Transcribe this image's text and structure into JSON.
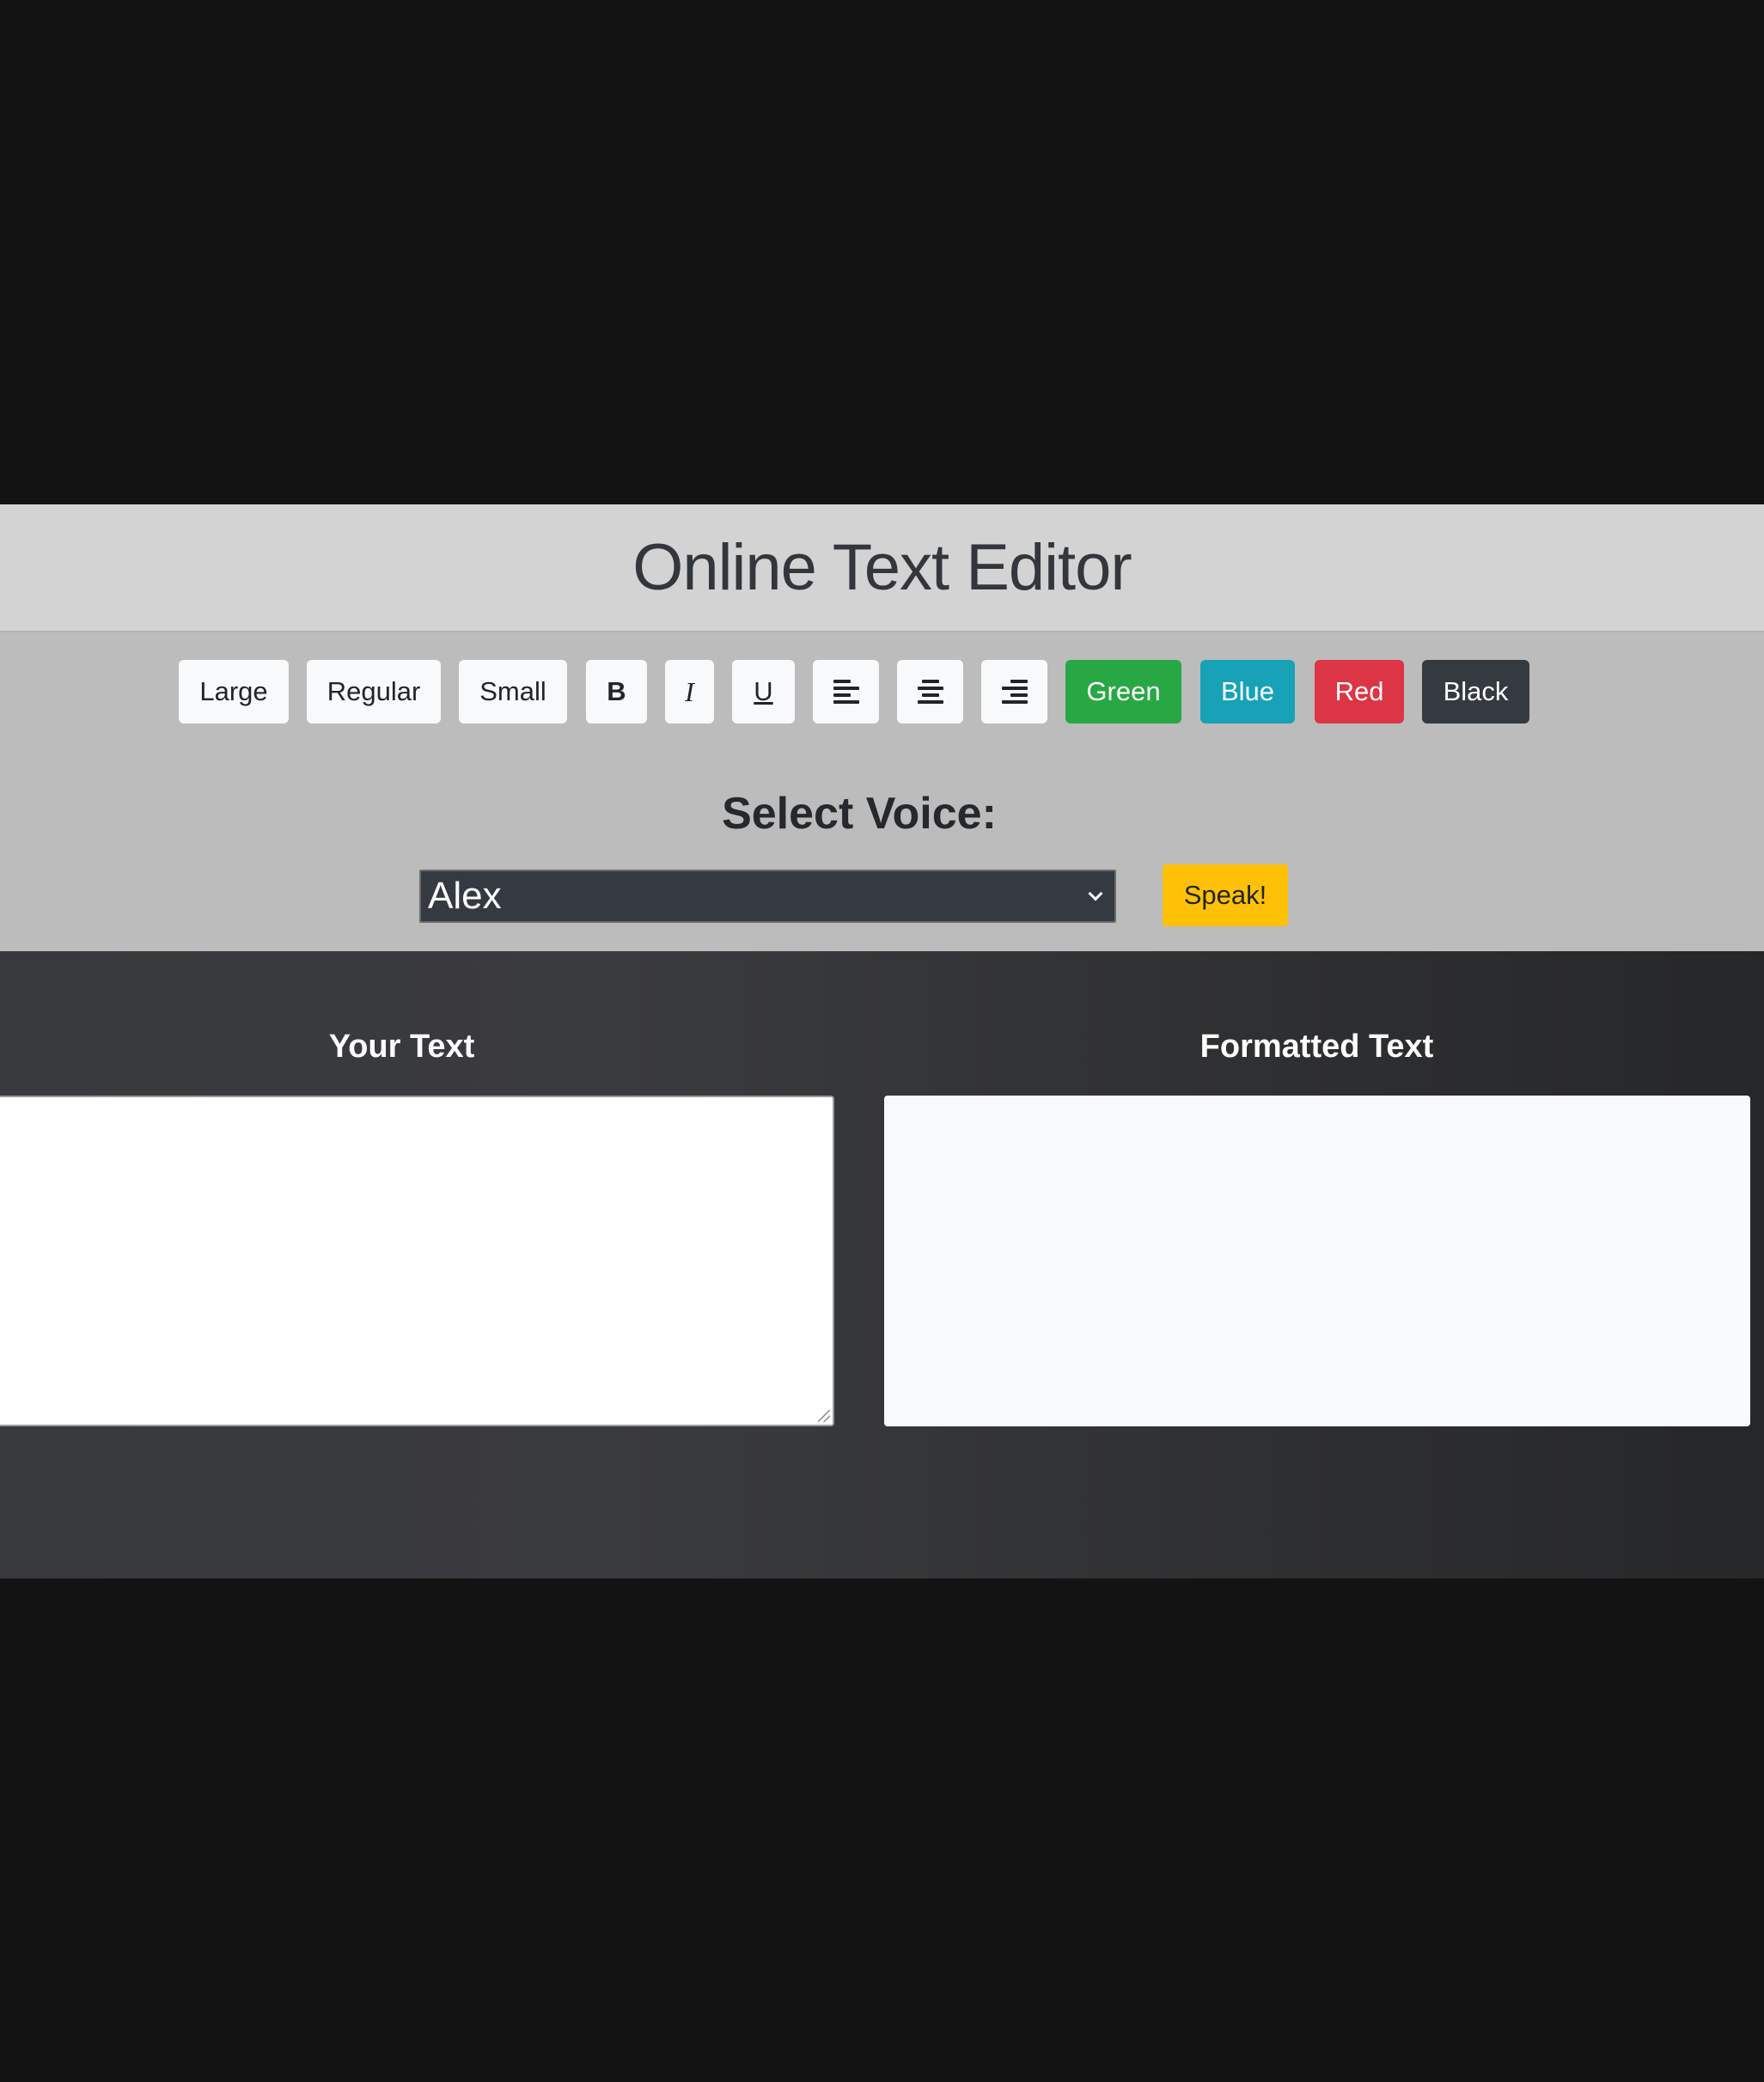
{
  "header": {
    "title": "Online Text Editor"
  },
  "toolbar": {
    "size_buttons": {
      "large": "Large",
      "regular": "Regular",
      "small": "Small"
    },
    "style_buttons": {
      "bold": "B",
      "italic": "I",
      "underline": "U"
    },
    "align_buttons": [
      "align-left-icon",
      "align-center-icon",
      "align-right-icon"
    ],
    "color_buttons": {
      "green": "Green",
      "blue": "Blue",
      "red": "Red",
      "black": "Black"
    },
    "colors": {
      "green": "#28a745",
      "blue": "#17a2b8",
      "red": "#dc3545",
      "black": "#343a40"
    }
  },
  "voice": {
    "label": "Select Voice:",
    "selected": "Alex",
    "speak_label": "Speak!",
    "speak_color": "#ffc107"
  },
  "editor": {
    "input_title": "Your Text",
    "input_value": "",
    "output_title": "Formatted Text",
    "output_value": ""
  }
}
